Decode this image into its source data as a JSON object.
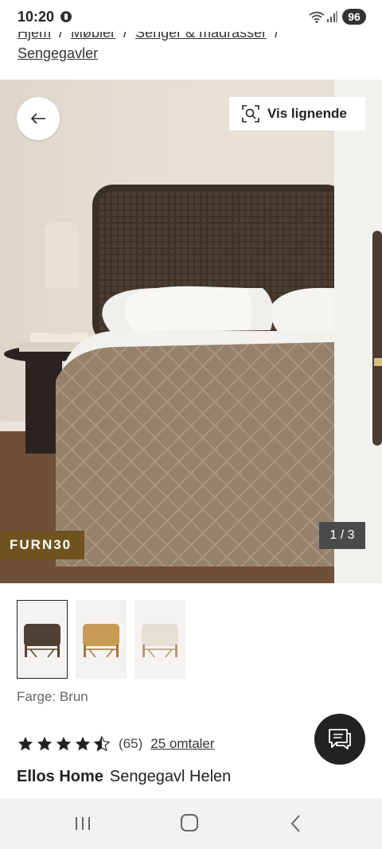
{
  "status_bar": {
    "time": "10:20",
    "battery": "96"
  },
  "breadcrumb": {
    "items": [
      "Hjem",
      "Møbler",
      "Senger & madrasser",
      "Sengegavler"
    ],
    "separator": "/"
  },
  "gallery": {
    "similar_label": "Vis lignende",
    "promo_code": "FURN30",
    "counter": "1 / 3"
  },
  "color": {
    "label": "Farge: Brun"
  },
  "rating": {
    "stars": 4.5,
    "count": "(65)",
    "reviews_link": "25 omtaler"
  },
  "product": {
    "brand": "Ellos Home",
    "name": "Sengegavl Helen"
  },
  "theme": {
    "promo_bg": "#6e5320",
    "counter_bg": "#4a4a4a",
    "chat_bg": "#222222"
  },
  "icons": [
    "pinterest-icon",
    "wifi-icon",
    "signal-icon",
    "arrow-left-icon",
    "visual-search-icon",
    "star-icon",
    "chat-icon",
    "recents-icon",
    "home-icon",
    "back-icon"
  ]
}
